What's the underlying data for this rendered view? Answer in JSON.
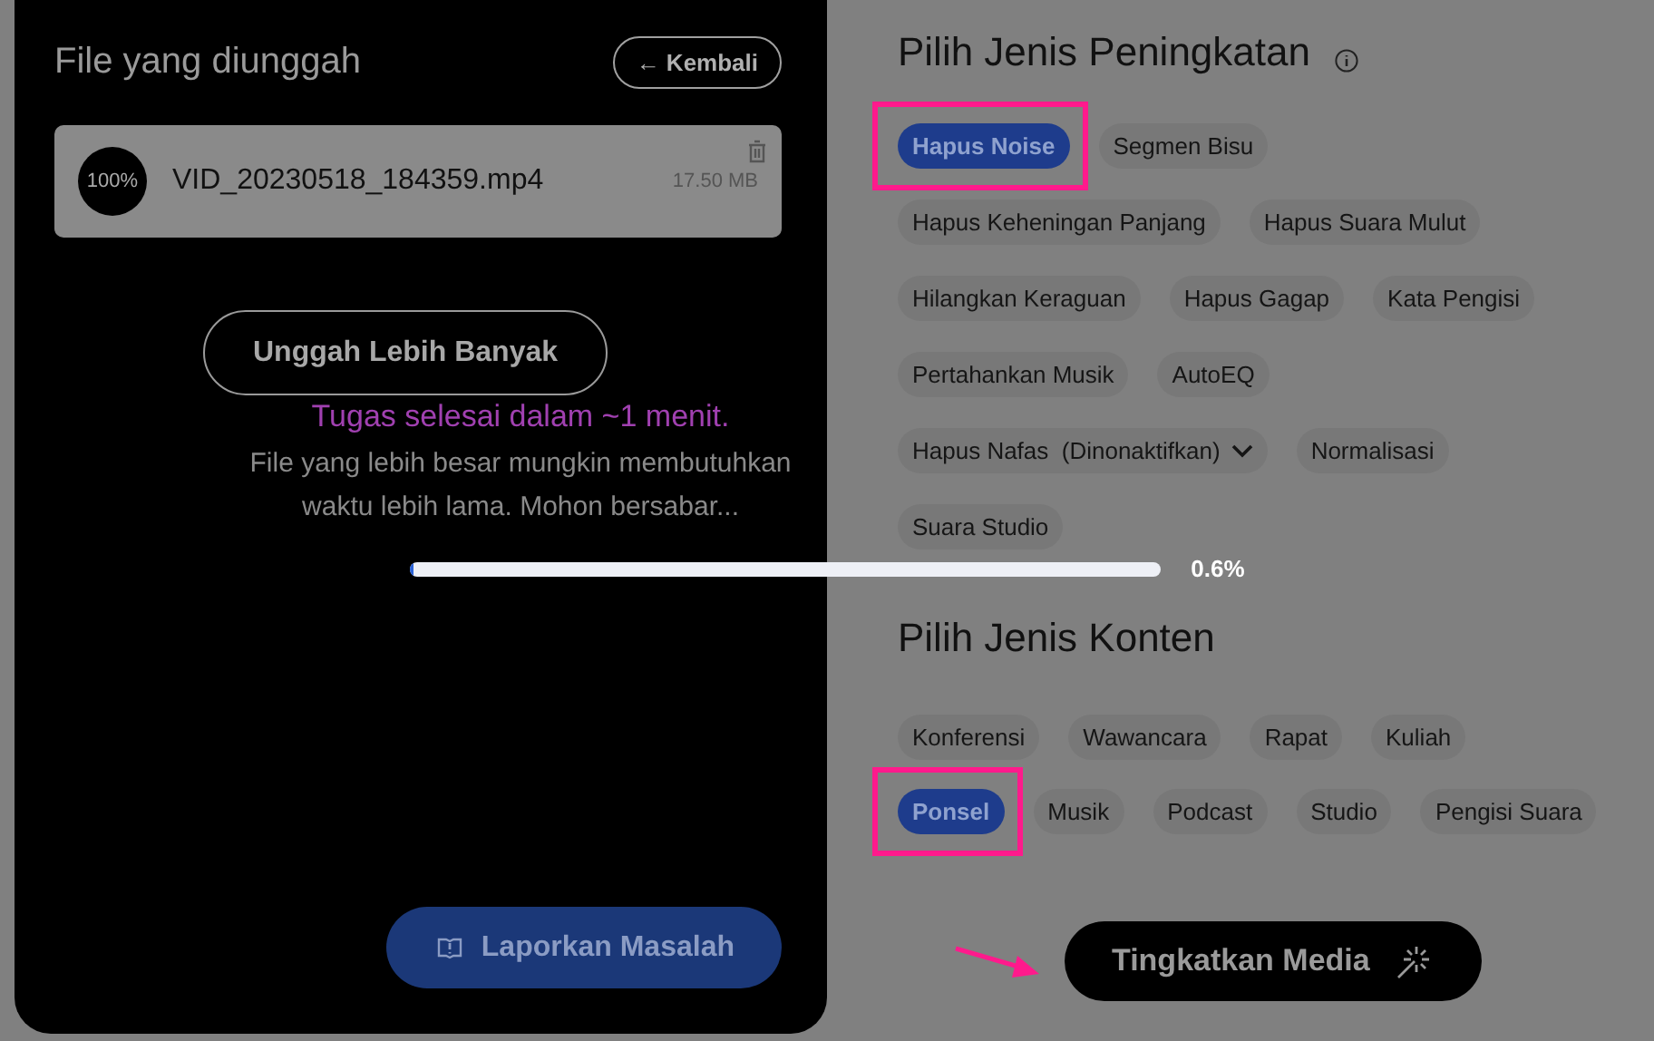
{
  "upload_panel": {
    "title": "File yang diunggah",
    "back_button": "← Kembali",
    "files": [
      {
        "progress": "100%",
        "name": "VID_20230518_184359.mp4",
        "size": "17.50 MB"
      }
    ],
    "upload_more_button": "Unggah Lebih Banyak",
    "report_button": "Laporkan Masalah"
  },
  "progress_overlay": {
    "eta": "Tugas selesai dalam ~1 menit.",
    "message": "File yang lebih besar mungkin membutuhkan waktu lebih lama. Mohon bersabar...",
    "level": 0.006,
    "reading": "0.6%"
  },
  "enhancement": {
    "title": "Pilih Jenis Peningkatan",
    "rows": [
      [
        {
          "label": "Hapus Noise",
          "kind": "chip",
          "selected": true,
          "highlighted": true
        },
        {
          "label": "Segmen Bisu",
          "kind": "chip",
          "selected": false,
          "highlighted": false
        }
      ],
      [
        {
          "label": "Hapus Keheningan Panjang",
          "kind": "chip",
          "selected": false,
          "highlighted": false
        },
        {
          "label": "Hapus Suara Mulut",
          "kind": "chip",
          "selected": false,
          "highlighted": false
        }
      ],
      [
        {
          "label": "Hilangkan Keraguan",
          "kind": "chip",
          "selected": false,
          "highlighted": false
        },
        {
          "label": "Hapus Gagap",
          "kind": "chip",
          "selected": false,
          "highlighted": false
        },
        {
          "label": "Kata Pengisi",
          "kind": "chip",
          "selected": false,
          "highlighted": false
        }
      ],
      [
        {
          "label": "Pertahankan Musik",
          "kind": "chip",
          "selected": false,
          "highlighted": false
        },
        {
          "label": "AutoEQ",
          "kind": "chip",
          "selected": false,
          "highlighted": false
        }
      ],
      [
        {
          "label": "Hapus Nafas  (Dinonaktifkan)",
          "kind": "dropdown",
          "selected": false,
          "highlighted": false
        },
        {
          "label": "Normalisasi",
          "kind": "chip",
          "selected": false,
          "highlighted": false
        }
      ],
      [
        {
          "label": "Suara Studio",
          "kind": "chip",
          "selected": false,
          "highlighted": false
        }
      ]
    ]
  },
  "content": {
    "title": "Pilih Jenis Konten",
    "rows": [
      [
        {
          "label": "Konferensi",
          "kind": "chip",
          "selected": false,
          "highlighted": false
        },
        {
          "label": "Wawancara",
          "kind": "chip",
          "selected": false,
          "highlighted": false
        },
        {
          "label": "Rapat",
          "kind": "chip",
          "selected": false,
          "highlighted": false
        },
        {
          "label": "Kuliah",
          "kind": "chip",
          "selected": false,
          "highlighted": false
        }
      ],
      [
        {
          "label": "Ponsel",
          "kind": "chip",
          "selected": true,
          "highlighted": true
        },
        {
          "label": "Musik",
          "kind": "chip",
          "selected": false,
          "highlighted": false
        },
        {
          "label": "Podcast",
          "kind": "chip",
          "selected": false,
          "highlighted": false
        },
        {
          "label": "Studio",
          "kind": "chip",
          "selected": false,
          "highlighted": false
        },
        {
          "label": "Pengisi Suara",
          "kind": "chip",
          "selected": false,
          "highlighted": false
        }
      ]
    ]
  },
  "enhance_button": "Tingkatkan Media"
}
